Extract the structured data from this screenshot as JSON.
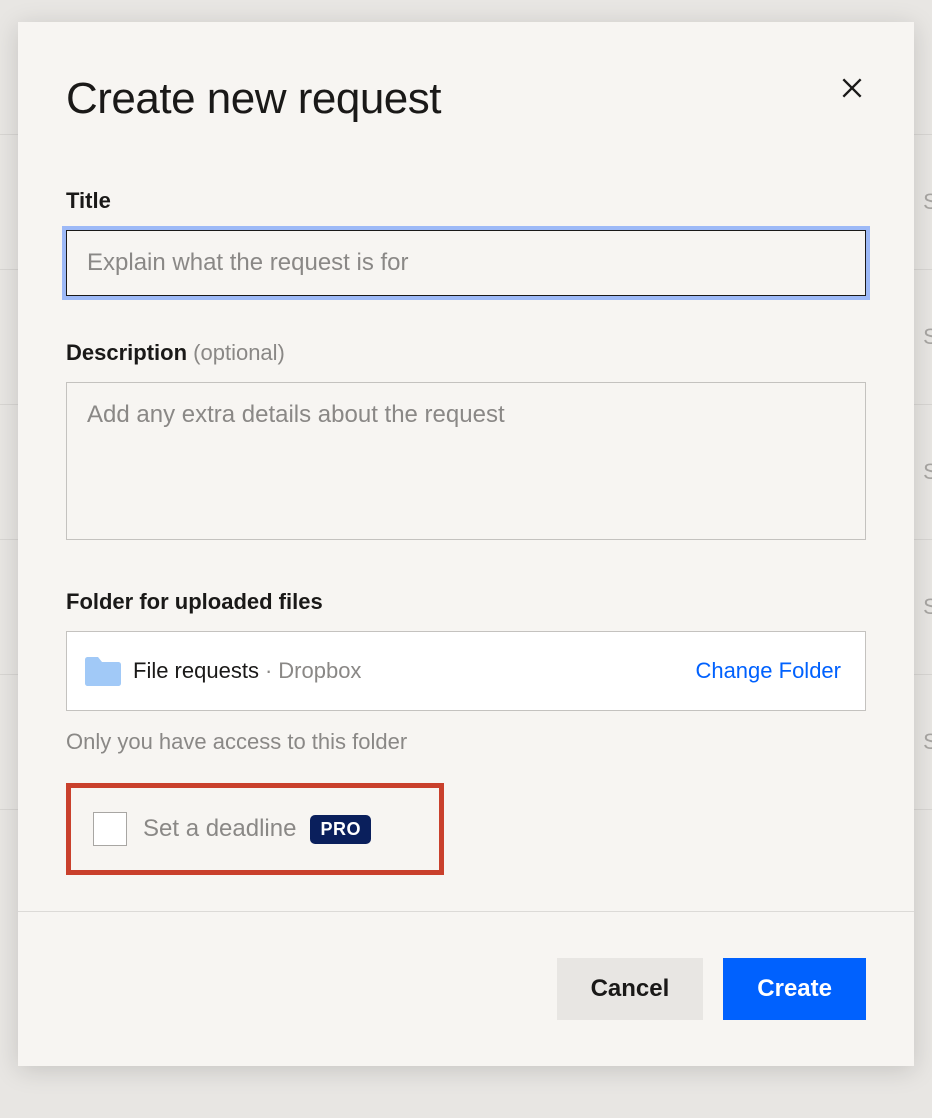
{
  "modal": {
    "title": "Create new request",
    "fields": {
      "title": {
        "label": "Title",
        "placeholder": "Explain what the request is for",
        "value": ""
      },
      "description": {
        "label": "Description",
        "optional_suffix": "(optional)",
        "placeholder": "Add any extra details about the request",
        "value": ""
      },
      "folder": {
        "label": "Folder for uploaded files",
        "name": "File requests",
        "separator": "·",
        "location": "Dropbox",
        "change_label": "Change Folder",
        "note": "Only you have access to this folder"
      },
      "deadline": {
        "label": "Set a deadline",
        "badge": "PRO"
      }
    },
    "footer": {
      "cancel": "Cancel",
      "create": "Create"
    }
  },
  "background": {
    "partial_text": "Su"
  }
}
